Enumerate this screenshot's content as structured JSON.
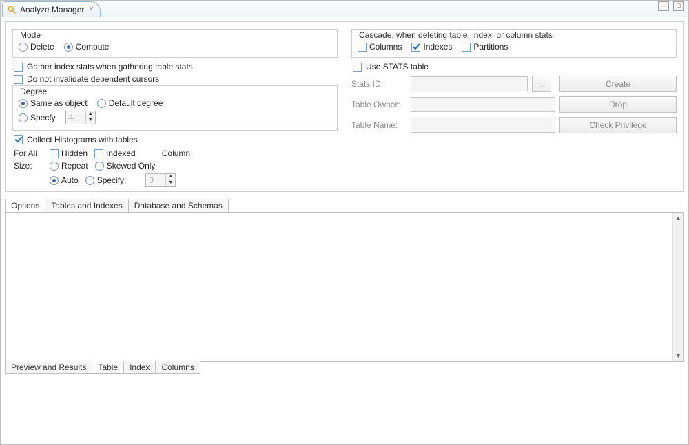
{
  "tab": {
    "title": "Analyze Manager"
  },
  "mode": {
    "legend": "Mode",
    "delete_label": "Delete",
    "compute_label": "Compute",
    "selected": "compute"
  },
  "gather_index_label": "Gather index stats when gathering table stats",
  "no_invalidate_label": "Do not invalidate dependent cursors",
  "degree": {
    "legend": "Degree",
    "same_label": "Same as object",
    "default_label": "Default degree",
    "specify_label": "Specfy",
    "specify_value": "4",
    "selected": "same"
  },
  "hist": {
    "collect_label": "Collect Histograms with tables",
    "for_all_label": "For All",
    "hidden_label": "Hidden",
    "indexed_label": "Indexed",
    "column_label": "Column",
    "size_label": "Size:",
    "repeat_label": "Repeat",
    "skewed_label": "Skewed Only",
    "auto_label": "Auto",
    "specify_label": "Specify:",
    "specify_value": "0",
    "size_selected": "auto"
  },
  "cascade": {
    "legend": "Cascade, when deleting table, index, or column stats",
    "columns_label": "Columns",
    "indexes_label": "Indexes",
    "partitions_label": "Partitions"
  },
  "stats": {
    "use_label": "Use STATS table",
    "id_label": "Stats ID :",
    "owner_label": "Table Owner:",
    "name_label": "Table Name:",
    "browse_label": "...",
    "create_label": "Create",
    "drop_label": "Drop",
    "check_label": "Check Privilege"
  },
  "mid_tabs": {
    "options": "Options",
    "tables_indexes": "Tables and Indexes",
    "db_schemas": "Database and Schemas"
  },
  "bottom_tabs": {
    "preview": "Preview and Results",
    "table": "Table",
    "index": "Index",
    "columns": "Columns"
  }
}
